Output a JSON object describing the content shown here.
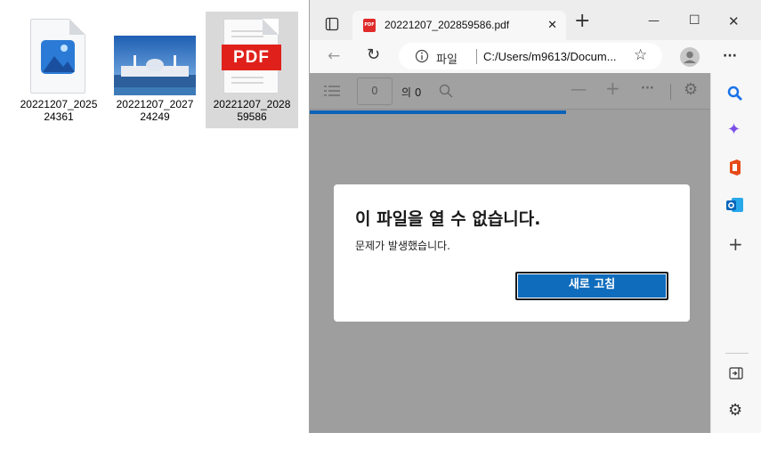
{
  "desktop": {
    "files": [
      {
        "name": "20221207_2025\n24361",
        "icon": "image-file-icon"
      },
      {
        "name": "20221207_2027\n24249",
        "icon": "photo-thumbnail"
      },
      {
        "name": "20221207_2028\n59586",
        "icon": "pdf-file-icon",
        "badge": "PDF"
      }
    ]
  },
  "browser": {
    "tab_title": "20221207_202859586.pdf",
    "tab_close": "✕",
    "new_tab": "+",
    "window_controls": {
      "minimize": "—",
      "maximize": "☐",
      "close": "✕"
    },
    "address": {
      "label": "파일",
      "url": "C:/Users/m9613/Docum..."
    },
    "pdf_toolbar": {
      "page_value": "0",
      "page_total": "의 0"
    },
    "colors": {
      "accent": "#0f6cbd",
      "progress": "#0c63b8",
      "overlay": "#9e9e9e"
    }
  },
  "dialog": {
    "title": "이 파일을 열 수 없습니다.",
    "message": "문제가 발생했습니다.",
    "button": "새로 고침"
  }
}
